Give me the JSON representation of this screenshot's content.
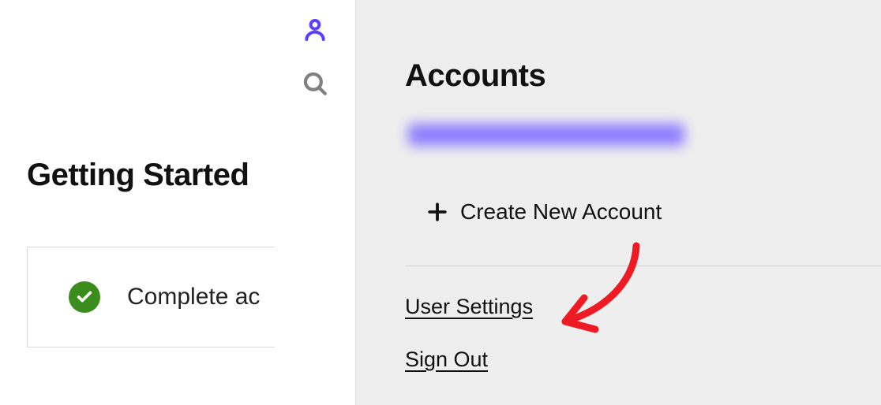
{
  "left": {
    "heading": "Getting Started",
    "card_text": "Complete ac"
  },
  "rail": {
    "user_icon": "user-icon",
    "search_icon": "search-icon"
  },
  "flyout": {
    "heading": "Accounts",
    "create_label": "Create New Account",
    "links": {
      "user_settings": "User Settings",
      "sign_out": "Sign Out"
    }
  }
}
